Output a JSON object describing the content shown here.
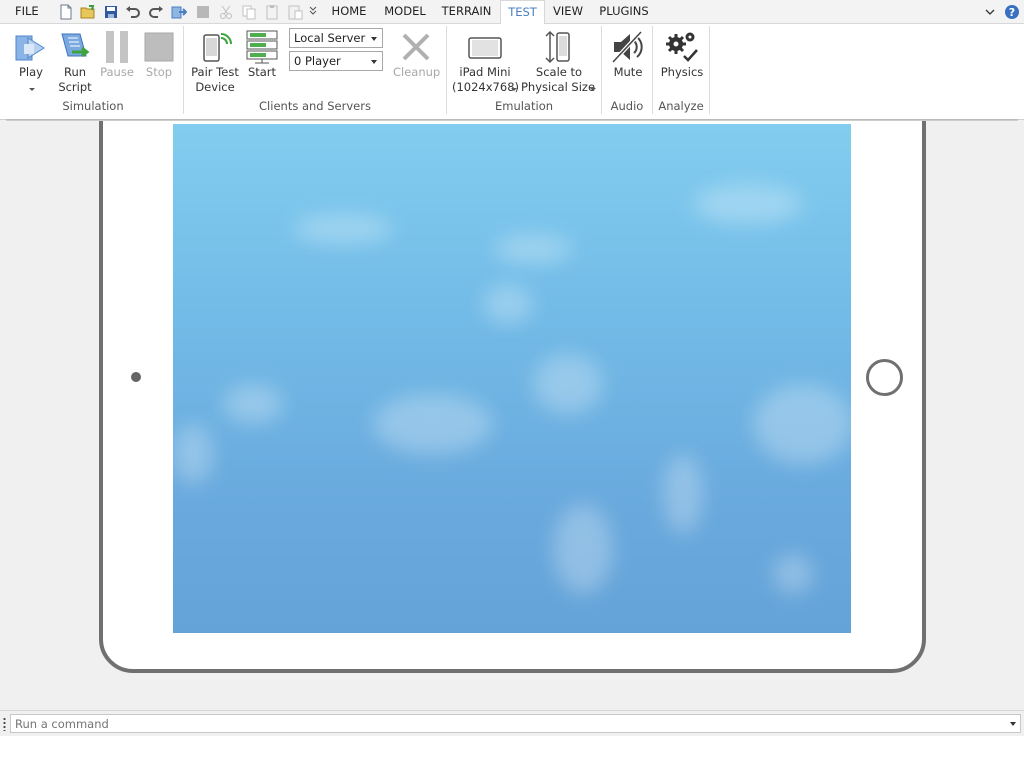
{
  "menu": {
    "file": "FILE",
    "tabs": [
      {
        "label": "HOME",
        "active": false
      },
      {
        "label": "MODEL",
        "active": false
      },
      {
        "label": "TERRAIN",
        "active": false
      },
      {
        "label": "TEST",
        "active": true
      },
      {
        "label": "VIEW",
        "active": false
      },
      {
        "label": "PLUGINS",
        "active": false
      }
    ],
    "quick_access_icons": [
      "new-file-icon",
      "open-file-icon",
      "save-icon",
      "undo-icon",
      "redo-icon",
      "publish-icon",
      "stop-square-icon",
      "cut-icon",
      "copy-icon",
      "paste-icon",
      "paste-into-icon",
      "customize-chevron-icon"
    ],
    "right_icons": [
      "collapse-ribbon-icon",
      "help-icon"
    ]
  },
  "ribbon": {
    "simulation": {
      "group_label": "Simulation",
      "play": "Play",
      "run_script": [
        "Run",
        "Script"
      ],
      "pause": "Pause",
      "stop": "Stop"
    },
    "clients_servers": {
      "group_label": "Clients and Servers",
      "pair_test_device": [
        "Pair Test",
        "Device"
      ],
      "start": "Start",
      "server_select": "Local Server",
      "player_select": "0 Player",
      "cleanup": "Cleanup"
    },
    "emulation": {
      "group_label": "Emulation",
      "device": [
        "iPad Mini",
        "(1024x768)"
      ],
      "scale": [
        "Scale to",
        "Physical Size"
      ]
    },
    "audio": {
      "group_label": "Audio",
      "mute": "Mute"
    },
    "analyze": {
      "group_label": "Analyze",
      "physics": "Physics"
    }
  },
  "command_bar": {
    "placeholder": "Run a command"
  },
  "colors": {
    "accent": "#4a7fc0",
    "sky_top": "#82cdef",
    "sky_bottom": "#64a3d8",
    "device_frame": "#707070"
  }
}
